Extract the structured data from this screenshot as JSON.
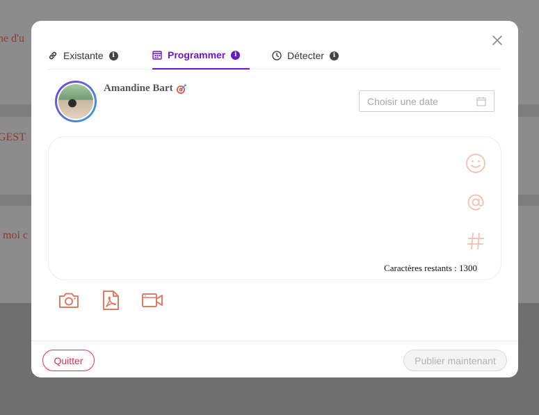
{
  "background": {
    "snippets": [
      "ne d'u",
      "GEST",
      "moi c"
    ]
  },
  "modal": {
    "tabs": [
      {
        "label": "Existante",
        "icon": "link-icon",
        "active": false
      },
      {
        "label": "Programmer",
        "icon": "calendar-icon",
        "active": true
      },
      {
        "label": "Détecter",
        "icon": "clock-icon",
        "active": false
      }
    ],
    "user": {
      "name": "Amandine Bart",
      "badge_icon": "target-icon"
    },
    "date_input": {
      "placeholder": "Choisir une date",
      "value": ""
    },
    "editor": {
      "value": "",
      "remaining_label": "Caractères restants : 1300",
      "icons": [
        "smiley-icon",
        "at-icon",
        "hashtag-icon"
      ]
    },
    "media_buttons": [
      "camera-icon",
      "pdf-icon",
      "video-icon"
    ],
    "footer": {
      "quit_label": "Quitter",
      "publish_label": "Publier maintenant"
    },
    "colors": {
      "accent": "#6a16c9",
      "icon_coral": "#e07a62",
      "editor_icon_light": "#f3c4b5",
      "danger": "#e0304a"
    }
  }
}
